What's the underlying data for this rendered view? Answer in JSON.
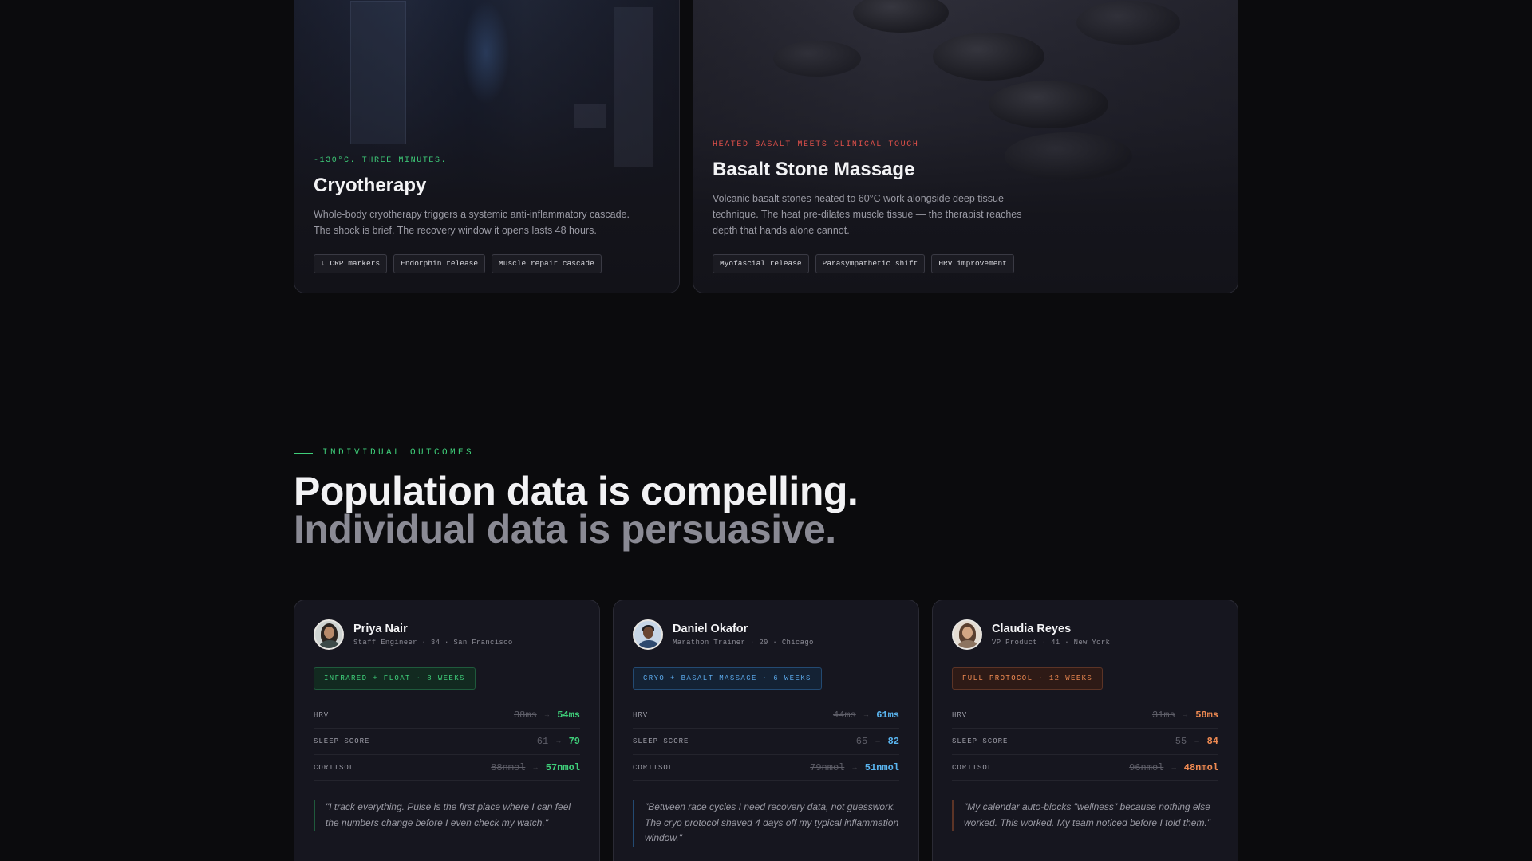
{
  "services": {
    "cryotherapy": {
      "eyebrow": "-130°C. THREE MINUTES.",
      "title": "Cryotherapy",
      "description": "Whole-body cryotherapy triggers a systemic anti-inflammatory cascade. The shock is brief. The recovery window it opens lasts 48 hours.",
      "tags": [
        "↓ CRP markers",
        "Endorphin release",
        "Muscle repair cascade"
      ],
      "accent_color": "#3fcf7a"
    },
    "basalt": {
      "eyebrow": "HEATED BASALT MEETS CLINICAL TOUCH",
      "title": "Basalt Stone Massage",
      "description": "Volcanic basalt stones heated to 60°C work alongside deep tissue technique. The heat pre-dilates muscle tissue — the therapist reaches depth that hands alone cannot.",
      "tags": [
        "Myofascial release",
        "Parasympathetic shift",
        "HRV improvement"
      ],
      "accent_color": "#e0504a"
    }
  },
  "outcomes": {
    "eyebrow": "INDIVIDUAL OUTCOMES",
    "headline": "Population data is compelling.",
    "subheadline": "Individual data is persuasive.",
    "testimonials": [
      {
        "name": "Priya Nair",
        "meta": "Staff Engineer · 34 · San Francisco",
        "protocol": "INFRARED + FLOAT · 8 WEEKS",
        "accent_color": "#3fcf7a",
        "metrics": [
          {
            "label": "HRV",
            "before": "38ms",
            "after": "54ms"
          },
          {
            "label": "SLEEP SCORE",
            "before": "61",
            "after": "79"
          },
          {
            "label": "CORTISOL",
            "before": "88nmol",
            "after": "57nmol"
          }
        ],
        "quote": "\"I track everything. Pulse is the first place where I can feel the numbers change before I even check my watch.\""
      },
      {
        "name": "Daniel Okafor",
        "meta": "Marathon Trainer · 29 · Chicago",
        "protocol": "CRYO + BASALT MASSAGE · 6 WEEKS",
        "accent_color": "#5ab5f0",
        "metrics": [
          {
            "label": "HRV",
            "before": "44ms",
            "after": "61ms"
          },
          {
            "label": "SLEEP SCORE",
            "before": "65",
            "after": "82"
          },
          {
            "label": "CORTISOL",
            "before": "79nmol",
            "after": "51nmol"
          }
        ],
        "quote": "\"Between race cycles I need recovery data, not guesswork. The cryo protocol shaved 4 days off my typical inflammation window.\""
      },
      {
        "name": "Claudia Reyes",
        "meta": "VP Product · 41 · New York",
        "protocol": "FULL PROTOCOL · 12 WEEKS",
        "accent_color": "#ef8a52",
        "metrics": [
          {
            "label": "HRV",
            "before": "31ms",
            "after": "58ms"
          },
          {
            "label": "SLEEP SCORE",
            "before": "55",
            "after": "84"
          },
          {
            "label": "CORTISOL",
            "before": "96nmol",
            "after": "48nmol"
          }
        ],
        "quote": "\"My calendar auto-blocks \"wellness\" because nothing else worked. This worked. My team noticed before I told them.\""
      }
    ]
  },
  "icons": {
    "metric_arrow": "→"
  }
}
